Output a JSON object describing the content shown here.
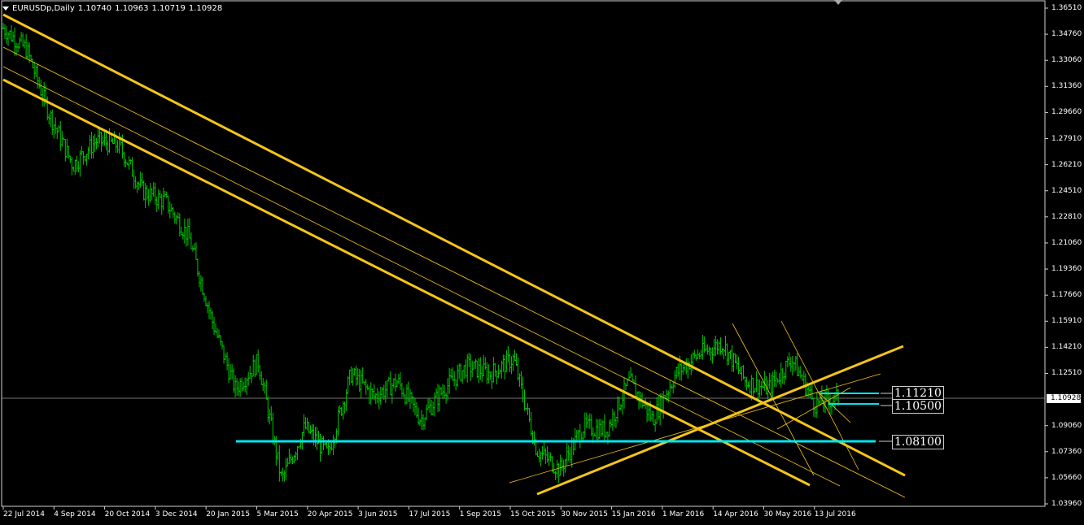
{
  "window": {
    "symbol": "EURUSDp,Daily",
    "open": "1.10740",
    "high": "1.10963",
    "low": "1.10719",
    "close": "1.10928"
  },
  "current_price": "1.10928",
  "levels": {
    "l1": "1.11210",
    "l2": "1.10500",
    "l3": "1.08100"
  },
  "colors": {
    "background": "#000000",
    "bars": "#00c800",
    "trendlines": "#f5c518",
    "support": "#00e5ee",
    "axis": "#ffffff"
  },
  "y_axis_labels": [
    "1.36510",
    "1.34760",
    "1.33060",
    "1.31360",
    "1.29660",
    "1.27910",
    "1.26210",
    "1.24510",
    "1.22810",
    "1.21060",
    "1.19360",
    "1.17660",
    "1.15910",
    "1.14210",
    "1.12510",
    "1.10928",
    "1.09060",
    "1.07360",
    "1.05660",
    "1.03960"
  ],
  "x_axis_labels": [
    "22 Jul 2014",
    "4 Sep 2014",
    "20 Oct 2014",
    "3 Dec 2014",
    "20 Jan 2015",
    "5 Mar 2015",
    "20 Apr 2015",
    "3 Jun 2015",
    "17 Jul 2015",
    "1 Sep 2015",
    "15 Oct 2015",
    "30 Nov 2015",
    "15 Jan 2016",
    "1 Mar 2016",
    "14 Apr 2016",
    "30 May 2016",
    "13 Jul 2016"
  ],
  "chart_data": {
    "type": "candlestick-bars",
    "ylim": [
      1.0396,
      1.3651
    ],
    "x_range": [
      "22 Jul 2014",
      "13 Jul 2016"
    ],
    "price_path_keypoints": [
      [
        "22 Jul 2014",
        1.352
      ],
      [
        "Aug 2014",
        1.338
      ],
      [
        "4 Sep 2014",
        1.295
      ],
      [
        "Sep 2014",
        1.262
      ],
      [
        "Oct 2014",
        1.278
      ],
      [
        "20 Oct 2014",
        1.275
      ],
      [
        "Nov 2014",
        1.245
      ],
      [
        "3 Dec 2014",
        1.238
      ],
      [
        "Dec 2014",
        1.215
      ],
      [
        "Jan 2015",
        1.16
      ],
      [
        "20 Jan 2015",
        1.115
      ],
      [
        "Feb 2015",
        1.133
      ],
      [
        "5 Mar 2015",
        1.055
      ],
      [
        "Mar 2015",
        1.09
      ],
      [
        "20 Apr 2015",
        1.072
      ],
      [
        "May 2015",
        1.125
      ],
      [
        "3 Jun 2015",
        1.11
      ],
      [
        "Jun 2015",
        1.12
      ],
      [
        "17 Jul 2015",
        1.095
      ],
      [
        "Aug 2015",
        1.115
      ],
      [
        "1 Sep 2015",
        1.13
      ],
      [
        "Sep 2015",
        1.125
      ],
      [
        "15 Oct 2015",
        1.135
      ],
      [
        "Nov 2015",
        1.075
      ],
      [
        "30 Nov 2015",
        1.062
      ],
      [
        "Dec 2015",
        1.09
      ],
      [
        "15 Jan 2016",
        1.088
      ],
      [
        "Feb 2016",
        1.12
      ],
      [
        "1 Mar 2016",
        1.095
      ],
      [
        "Mar 2016",
        1.125
      ],
      [
        "14 Apr 2016",
        1.138
      ],
      [
        "Apr 2016",
        1.145
      ],
      [
        "May 2016",
        1.12
      ],
      [
        "30 May 2016",
        1.115
      ],
      [
        "Jun 2016",
        1.135
      ],
      [
        "13 Jul 2016",
        1.105
      ],
      [
        "Jul 2016",
        1.1093
      ]
    ],
    "horizontal_levels": [
      1.1121,
      1.105,
      1.081
    ],
    "grid": false
  }
}
